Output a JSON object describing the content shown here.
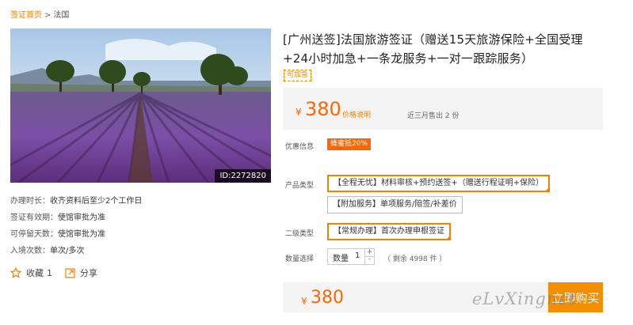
{
  "breadcrumb": {
    "home": "签证首页",
    "separator": ">",
    "current": "法国"
  },
  "photo": {
    "image_id": "ID:2272820",
    "subject": "lavender field"
  },
  "product": {
    "title": "[广州送签]法国旅游签证（赠送15天旅游保险+全国受理+24小时加急+一条龙服务+一对一跟踪服务）",
    "refund_tag": "可加急"
  },
  "info": {
    "processing_label": "办理时长：",
    "processing_value": "收齐资料后至少2个工作日",
    "validity_label": "签证有效期：",
    "validity_value": "使馆审批为准",
    "stay_label": "可停留天数：",
    "stay_value": "使馆审批为准",
    "entries_label": "入境次数：",
    "entries_value": "单次/多次"
  },
  "actions": {
    "favorite_label": "收藏",
    "favorite_count": "1",
    "share_label": "分享"
  },
  "price": {
    "currency": "¥",
    "amount": "380",
    "desc_link": "价格说明",
    "sold": "近三月售出 2 份"
  },
  "promo": {
    "label": "优惠信息",
    "badge": "蜂蜜抵20%"
  },
  "options": {
    "product_type_label": "产品类型",
    "product_types": [
      "【全程无忧】材料审核+预约送签+（赠送行程证明+保险）",
      "【附加服务】单项服务/陪签/补差价"
    ],
    "level2_label": "二级类型",
    "level2_types": [
      "【常规办理】首次办理申根签证"
    ],
    "quantity_label": "数量选择"
  },
  "quantity": {
    "label": "数量",
    "value": "1",
    "inc": "+",
    "dec": "-",
    "stock": "（ 剩余 4998 件 ）"
  },
  "buy": {
    "currency": "¥",
    "amount": "380",
    "button": "立即购买"
  },
  "watermark": "eLvXingnet",
  "colors": {
    "accent": "#f08200",
    "price": "#ff6600",
    "button": "#f28e00"
  }
}
